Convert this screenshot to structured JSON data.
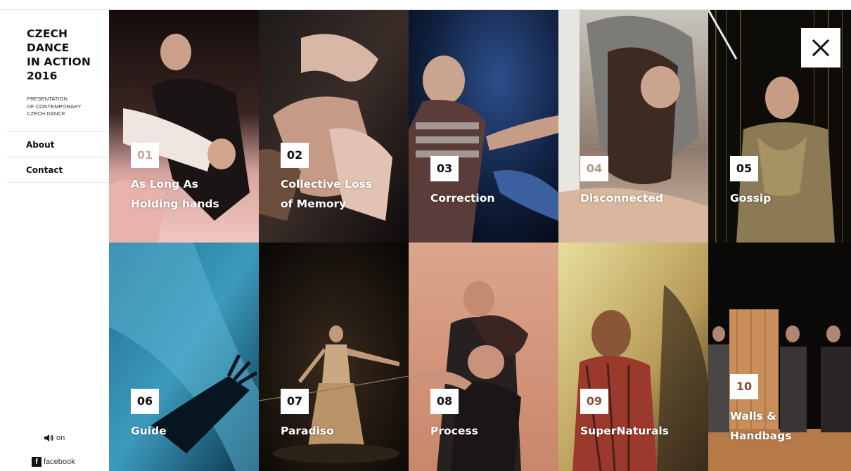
{
  "sidebar": {
    "logo": [
      "CZECH",
      "DANCE",
      "IN ACTION",
      "2016"
    ],
    "subtitle": [
      "PRESENTATION",
      "OF CONTEMPORARY",
      "CZECH DANCE"
    ],
    "nav": [
      {
        "label": "About"
      },
      {
        "label": "Contact"
      }
    ],
    "sound_label": "on",
    "facebook_label": "facebook",
    "facebook_glyph": "f"
  },
  "colors": {
    "accent": "#111111",
    "background": "#ffffff"
  },
  "close_icon": "close-icon",
  "performances": [
    {
      "number": "01",
      "title": "As Long As\nHolding hands"
    },
    {
      "number": "02",
      "title": "Collective Loss\nof Memory"
    },
    {
      "number": "03",
      "title": "Correction"
    },
    {
      "number": "04",
      "title": "Disconnected"
    },
    {
      "number": "05",
      "title": "Gossip"
    },
    {
      "number": "06",
      "title": "Guide"
    },
    {
      "number": "07",
      "title": "Paradiso"
    },
    {
      "number": "08",
      "title": "Process"
    },
    {
      "number": "09",
      "title": "SuperNaturals"
    },
    {
      "number": "10",
      "title": "Walls &\nHandbags"
    }
  ]
}
